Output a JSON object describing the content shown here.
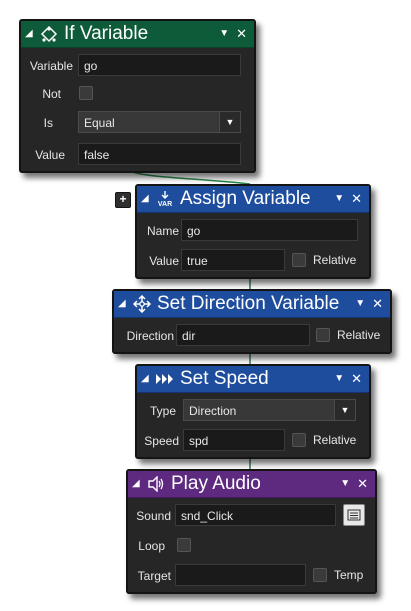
{
  "blocks": {
    "if_variable": {
      "title": "If Variable",
      "header_color": "#0e5b3a",
      "icon": "condition-icon",
      "fields": {
        "variable_label": "Variable",
        "variable_value": "go",
        "not_label": "Not",
        "is_label": "Is",
        "is_value": "Equal",
        "value_label": "Value",
        "value_value": "false"
      }
    },
    "assign_variable": {
      "title": "Assign Variable",
      "header_color": "#1e4d9e",
      "icon": "var-icon",
      "icon_text": "VAR",
      "fields": {
        "name_label": "Name",
        "name_value": "go",
        "value_label": "Value",
        "value_value": "true",
        "relative_label": "Relative"
      }
    },
    "set_direction_variable": {
      "title": "Set Direction Variable",
      "header_color": "#1e4d9e",
      "icon": "move-arrows-icon",
      "fields": {
        "direction_label": "Direction",
        "direction_value": "dir",
        "relative_label": "Relative"
      }
    },
    "set_speed": {
      "title": "Set Speed",
      "header_color": "#1e4d9e",
      "icon": "speed-arrows-icon",
      "fields": {
        "type_label": "Type",
        "type_value": "Direction",
        "speed_label": "Speed",
        "speed_value": "spd",
        "relative_label": "Relative"
      }
    },
    "play_audio": {
      "title": "Play Audio",
      "header_color": "#5e2a80",
      "icon": "speaker-icon",
      "fields": {
        "sound_label": "Sound",
        "sound_value": "snd_Click",
        "loop_label": "Loop",
        "target_label": "Target",
        "target_value": "",
        "temp_label": "Temp"
      }
    }
  },
  "add_button": "+"
}
